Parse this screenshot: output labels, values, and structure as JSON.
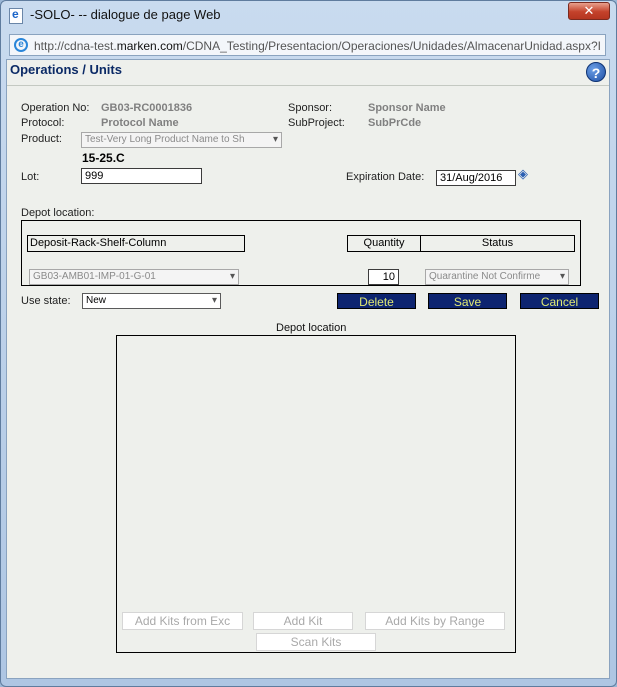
{
  "window": {
    "title": "-SOLO- -- dialogue de page Web",
    "close_label": "✕",
    "url_prefix": "http://cdna-test.",
    "url_domain": "marken.com",
    "url_path": "/CDNA_Testing/Presentacion/Operaciones/Unidades/AlmacenarUnidad.aspx?I"
  },
  "page": {
    "title": "Operations / Units",
    "help_label": "?"
  },
  "info": {
    "operation_label": "Operation No:",
    "operation_value": "GB03-RC0001836",
    "protocol_label": "Protocol:",
    "protocol_value": "Protocol Name",
    "sponsor_label": "Sponsor:",
    "sponsor_value": "Sponsor Name",
    "subproject_label": "SubProject:",
    "subproject_value": "SubPrCde",
    "product_label": "Product:",
    "product_value": "Test-Very Long Product Name to Sh",
    "product_code": "15-25.C",
    "lot_label": "Lot:",
    "lot_value": "999",
    "expiration_label": "Expiration Date:",
    "expiration_value": "31/Aug/2016"
  },
  "depot": {
    "section_label": "Depot location:",
    "col_location": "Deposit-Rack-Shelf-Column",
    "col_quantity": "Quantity",
    "col_status": "Status",
    "row_location": "GB03-AMB01-IMP-01-G-01",
    "row_quantity": "10",
    "row_status": "Quarantine Not Confirme"
  },
  "use_state": {
    "label": "Use state:",
    "value": "New"
  },
  "actions": {
    "delete": "Delete",
    "save": "Save",
    "cancel": "Cancel"
  },
  "kits": {
    "panel_title": "Depot location",
    "add_from_excel": "Add Kits from Exc",
    "add_kit": "Add Kit",
    "add_by_range": "Add Kits by Range",
    "scan": "Scan Kits"
  },
  "colors": {
    "button_bg": "#0d2470",
    "button_text": "#dfe873",
    "title_text": "#0b2a66"
  }
}
